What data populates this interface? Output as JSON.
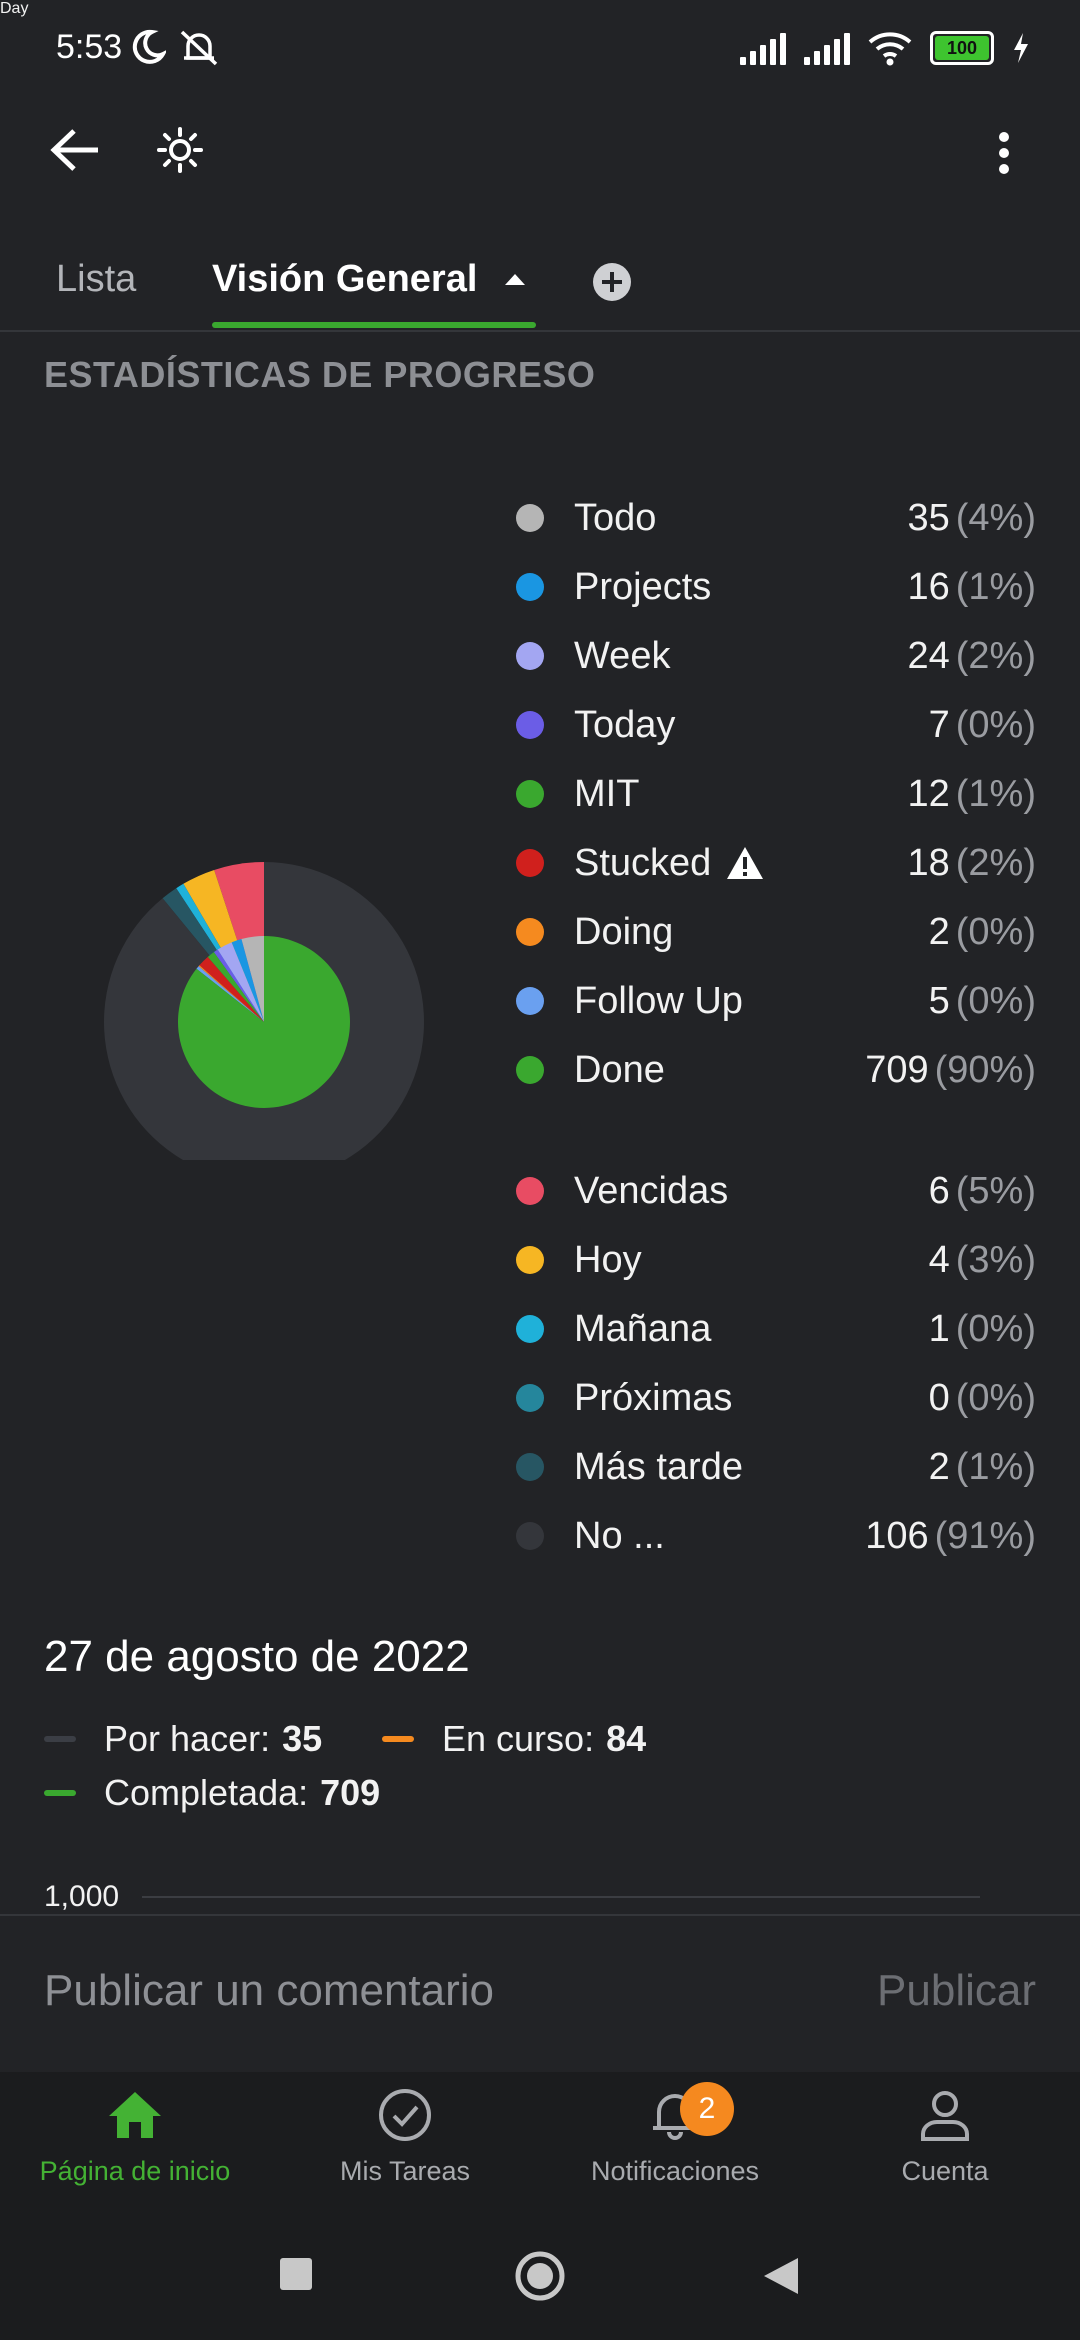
{
  "status_bar": {
    "time": "5:53",
    "battery": "100"
  },
  "app_bar": {
    "title": "Day"
  },
  "tabs": [
    {
      "label": "Lista",
      "active": false
    },
    {
      "label": "Visión General",
      "active": true
    }
  ],
  "section_title": "ESTADÍSTICAS DE PROGRESO",
  "status_legend": [
    {
      "label": "Todo",
      "count": "35",
      "pct": "(4%)",
      "color": "#b5b5b5"
    },
    {
      "label": "Projects",
      "count": "16",
      "pct": "(1%)",
      "color": "#1a96e2"
    },
    {
      "label": "Week",
      "count": "24",
      "pct": "(2%)",
      "color": "#a3a6f2"
    },
    {
      "label": "Today",
      "count": "7",
      "pct": "(0%)",
      "color": "#6b5de6"
    },
    {
      "label": "MIT",
      "count": "12",
      "pct": "(1%)",
      "color": "#3aa82f"
    },
    {
      "label": "Stucked",
      "count": "18",
      "pct": "(2%)",
      "color": "#d0201d"
    },
    {
      "label": "Doing",
      "count": "2",
      "pct": "(0%)",
      "color": "#f58a1f"
    },
    {
      "label": "Follow Up",
      "count": "5",
      "pct": "(0%)",
      "color": "#6aa0f0"
    },
    {
      "label": "Done",
      "count": "709",
      "pct": "(90%)",
      "color": "#3aa82f"
    }
  ],
  "due_legend": [
    {
      "label": "Vencidas",
      "count": "6",
      "pct": "(5%)",
      "color": "#e84c63"
    },
    {
      "label": "Hoy",
      "count": "4",
      "pct": "(3%)",
      "color": "#f6b623"
    },
    {
      "label": "Mañana",
      "count": "1",
      "pct": "(0%)",
      "color": "#1fb1d9"
    },
    {
      "label": "Próximas",
      "count": "0",
      "pct": "(0%)",
      "color": "#25869c"
    },
    {
      "label": "Más tarde",
      "count": "2",
      "pct": "(1%)",
      "color": "#275663"
    },
    {
      "label": "No ...",
      "count": "106",
      "pct": "(91%)",
      "color": "#34363b"
    }
  ],
  "progress": {
    "date": "27 de agosto de 2022",
    "series": [
      {
        "label": "Por hacer:",
        "value": "35",
        "color": "#3b3e45"
      },
      {
        "label": "En curso:",
        "value": "84",
        "color": "#f58a1f"
      },
      {
        "label": "Completada:",
        "value": "709",
        "color": "#3aa82f"
      }
    ],
    "y_tick": "1,000"
  },
  "comment": {
    "placeholder": "Publicar un comentario",
    "post_label": "Publicar"
  },
  "bottom_nav": [
    {
      "label": "Página de inicio",
      "icon": "home-icon",
      "active": true
    },
    {
      "label": "Mis Tareas",
      "icon": "check-circle-icon",
      "active": false
    },
    {
      "label": "Notificaciones",
      "icon": "bell-icon",
      "active": false,
      "badge": "2"
    },
    {
      "label": "Cuenta",
      "icon": "person-icon",
      "active": false
    }
  ]
}
